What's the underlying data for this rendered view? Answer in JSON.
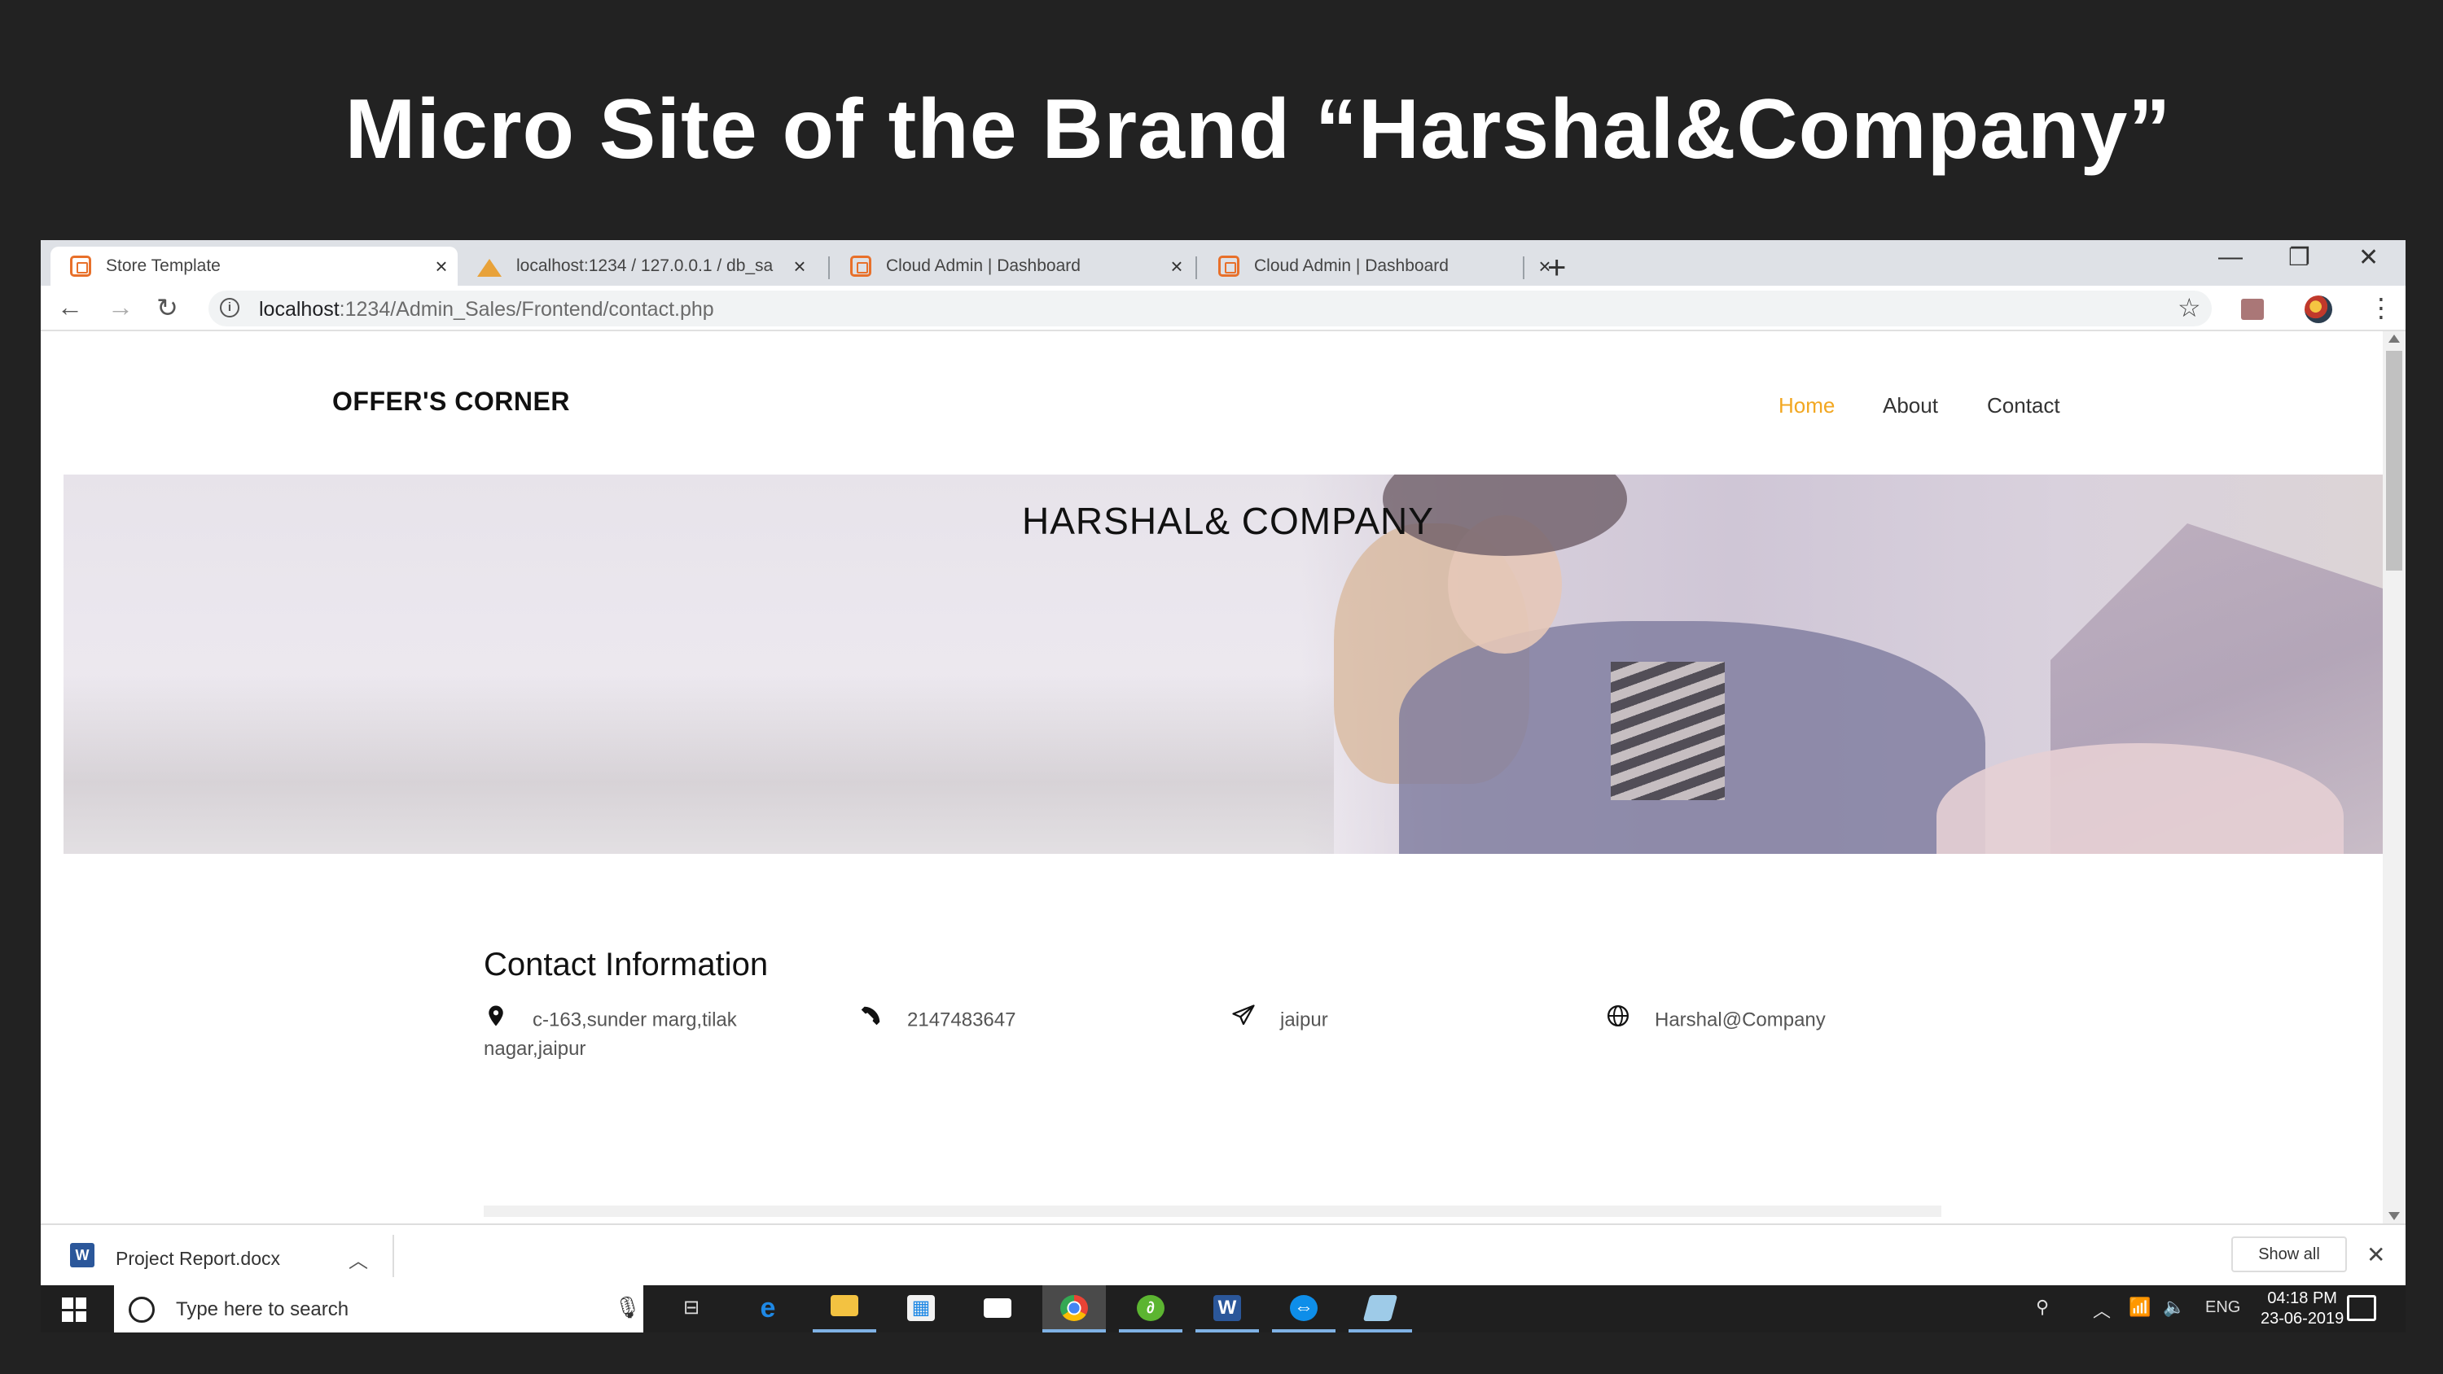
{
  "slide": {
    "title": "Micro Site of the Brand “Harshal&Company”"
  },
  "browser": {
    "tabs": [
      {
        "label": "Store Template"
      },
      {
        "label": "localhost:1234 / 127.0.0.1 / db_sa"
      },
      {
        "label": "Cloud Admin | Dashboard"
      },
      {
        "label": "Cloud Admin | Dashboard"
      }
    ],
    "new_tab": "+",
    "url_host": "localhost",
    "url_path": ":1234/Admin_Sales/Frontend/contact.php",
    "window_controls": {
      "minimize": "—",
      "maximize": "❐",
      "close": "✕"
    }
  },
  "site": {
    "logo": "OFFER'S CORNER",
    "nav": [
      {
        "label": "Home",
        "active": true
      },
      {
        "label": "About",
        "active": false
      },
      {
        "label": "Contact",
        "active": false
      }
    ],
    "hero_title": "HARSHAL& COMPANY",
    "contact": {
      "heading": "Contact Information",
      "address_line1": "c-163,sunder marg,tilak",
      "address_line2": "nagar,jaipur",
      "phone": "2147483647",
      "city": "jaipur",
      "website": "Harshal@Company",
      "icons": [
        "map-pin-icon",
        "phone-icon",
        "paper-plane-icon",
        "globe-icon"
      ]
    },
    "accent_color": "#f2a721"
  },
  "download_bar": {
    "file": "Project Report.docx",
    "show_all": "Show all"
  },
  "taskbar": {
    "search_placeholder": "Type here to search",
    "language": "ENG",
    "time": "04:18 PM",
    "date": "23-06-2019"
  }
}
